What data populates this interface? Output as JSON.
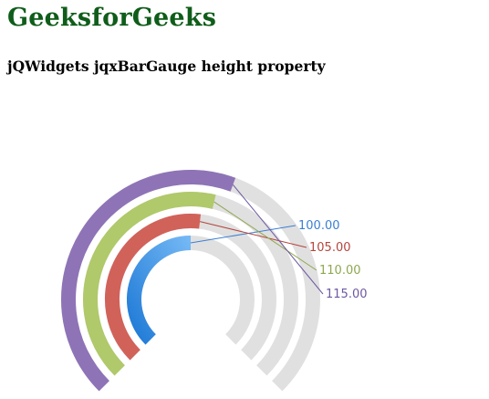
{
  "page": {
    "site_title": "GeeksforGeeks",
    "heading": "jQWidgets jqxBarGauge height property"
  },
  "chart_data": {
    "type": "bar-gauge",
    "min": 0,
    "max": 200,
    "start_angle_deg": 225,
    "end_angle_deg": -45,
    "track_color": "#e0e0e0",
    "values": [
      100,
      105,
      110,
      115
    ],
    "labels": [
      "100.00",
      "105.00",
      "110.00",
      "115.00"
    ],
    "colors": [
      "#5aa9f0",
      "#d1625a",
      "#b0c96a",
      "#8e74b6"
    ],
    "label_colors": [
      "#3c7fd3",
      "#b5453d",
      "#8ea850",
      "#6d58a1"
    ]
  }
}
